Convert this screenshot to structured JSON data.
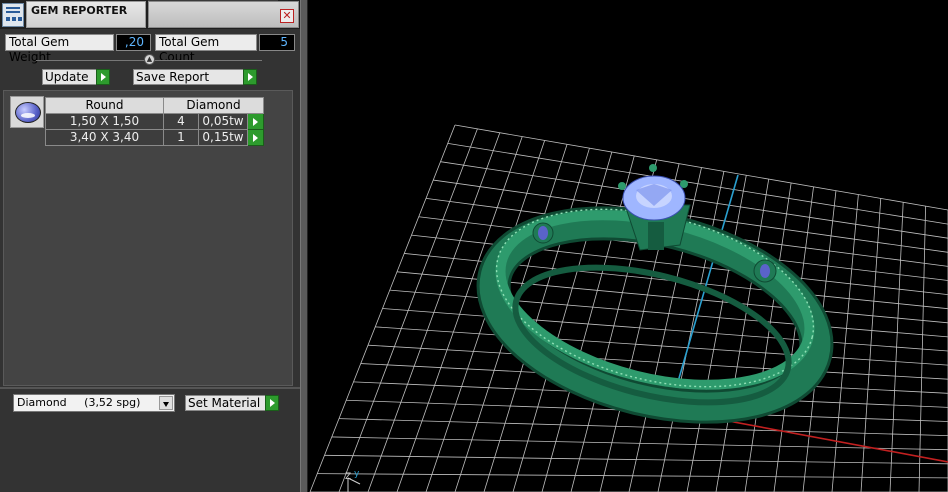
{
  "panel": {
    "title": "GEM REPORTER",
    "close_glyph": "✕",
    "total_weight_label": "Total Gem Weight",
    "total_weight_value": ",20",
    "total_count_label": "Total Gem Count",
    "total_count_value": "5",
    "update_label": "Update",
    "save_report_label": "Save Report",
    "table": {
      "headers": [
        "Round",
        "Diamond"
      ],
      "rows": [
        {
          "size": "1,50 X 1,50",
          "count": "4",
          "weight": "0,05tw"
        },
        {
          "size": "3,40 X 3,40",
          "count": "1",
          "weight": "0,15tw"
        }
      ]
    },
    "material_select": "Diamond     (3,52 spg)",
    "set_material_label": "Set Material"
  },
  "viewport": {
    "axis_labels": {
      "z": "Z",
      "y": "y"
    },
    "colors": {
      "ring": "#1f7a55",
      "gem": "#9fb6ff",
      "grid": "#bfbfbf",
      "x_axis": "#c22020",
      "y_axis": "#2aa0d0"
    }
  },
  "icons": {
    "app": "gem-reporter-icon",
    "close": "close-icon",
    "play": "play-icon",
    "dropdown": "chevron-down-icon",
    "gem": "gem-thumbnail-icon"
  }
}
